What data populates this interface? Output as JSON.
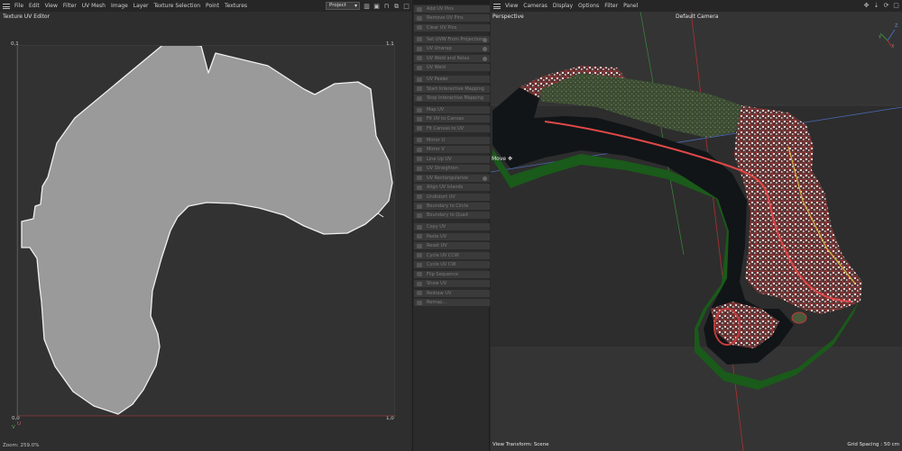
{
  "uv_editor": {
    "menu": [
      "File",
      "Edit",
      "View",
      "Filter",
      "UV Mesh",
      "Image",
      "Layer",
      "Texture Selection",
      "Point",
      "Textures"
    ],
    "project_select": "Project",
    "title": "Texture UV Editor",
    "corners": {
      "top_left": "0,1",
      "top_right": "1,1",
      "bottom_left": "0,0",
      "bottom_right": "1,0"
    },
    "axis_labels": {
      "u": "U",
      "v": "V"
    },
    "zoom_status": "Zoom: 259.0%"
  },
  "uv_commands": {
    "groups": [
      [
        "Add UV Pins",
        "Remove UV Pins",
        "Clear UV Pins"
      ],
      [
        "Set UVW From Projection",
        "UV Unwrap",
        "UV Weld and Relax",
        "UV Weld"
      ],
      [
        "UV Peeler",
        "Start Interactive Mapping",
        "Stop Interactive Mapping"
      ],
      [
        "Map UV",
        "Fit UV to Canvas",
        "Fit Canvas to UV"
      ],
      [
        "Mirror U",
        "Mirror V",
        "Line Up UV",
        "UV Straighten",
        "UV Rectangularize",
        "Align UV Islands",
        "Undistort UV",
        "Boundary to Circle",
        "Boundary to Quad"
      ],
      [
        "Copy UV",
        "Paste UV",
        "Reset UV",
        "Cycle UV CCW",
        "Cycle UV CW",
        "Flip Sequence",
        "Show UV",
        "Redraw UV",
        "Remap..."
      ]
    ],
    "gear_items": [
      "Set UVW From Projection",
      "UV Unwrap",
      "UV Weld and Relax",
      "UV Rectangularize"
    ]
  },
  "viewport": {
    "menu": [
      "View",
      "Cameras",
      "Display",
      "Options",
      "Filter",
      "Panel"
    ],
    "view_name": "Perspective",
    "camera": "Default Camera",
    "tool_label": "Move",
    "view_transform": "View Transform: Scene",
    "grid_spacing": "Grid Spacing : 50 cm",
    "axis": {
      "x": "X",
      "y": "Y",
      "z": "Z"
    }
  },
  "colors": {
    "uv_fill": "#9a9a9a",
    "uv_edge": "#f0f0f0",
    "grid_axis_green": "#3a8a3a",
    "grid_axis_red": "#b03030",
    "horizon_blue": "#4a6ab8",
    "map_red": "#c23a3a",
    "map_green_edge": "#1d7a1d"
  }
}
